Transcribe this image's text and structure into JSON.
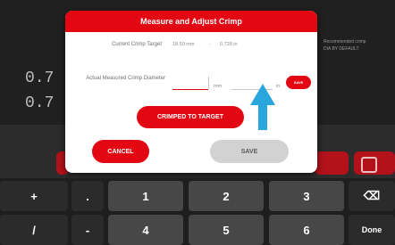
{
  "background": {
    "readouts": [
      "0.7",
      "0.7"
    ],
    "right_lines": [
      "Recommended crimp",
      "DIA BY DEFAULT"
    ]
  },
  "dialog": {
    "title": "Measure and Adjust Crimp",
    "current_target_label": "Current Crimp Target",
    "current_target_value_mm": "18.50 mm",
    "current_target_separator": "-",
    "current_target_value_in": "0.728 in",
    "measured_label": "Actual Measured Crimp Diameter",
    "unit_mm": "mm",
    "unit_in": "in",
    "save_small_label": "SAVE",
    "crimped_button": "CRIMPED TO TARGET",
    "cancel_button": "CANCEL",
    "save_button": "SAVE"
  },
  "keyboard": {
    "row1": [
      "+",
      ".",
      "1",
      "2",
      "3",
      "⌫"
    ],
    "row2": [
      "/",
      "-",
      "4",
      "5",
      "6",
      "Done"
    ]
  },
  "colors": {
    "accent": "#e30613",
    "highlight_arrow": "#2aa6df"
  }
}
